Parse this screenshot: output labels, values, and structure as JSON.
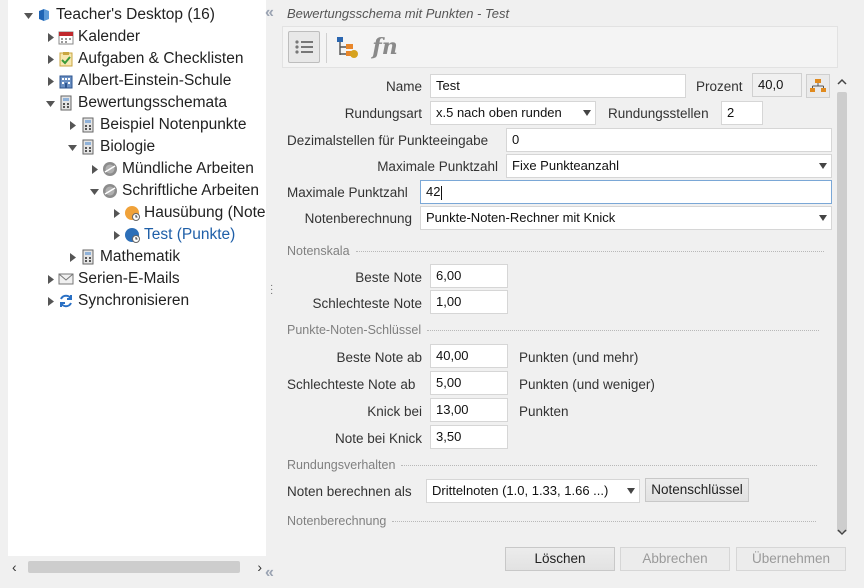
{
  "tree": {
    "items": [
      {
        "label": "Teacher's Desktop (16)",
        "icon": "desktop-icon",
        "expanded": true
      },
      {
        "label": "Kalender",
        "icon": "calendar-icon",
        "expanded": false
      },
      {
        "label": "Aufgaben & Checklisten",
        "icon": "checklist-icon",
        "expanded": false
      },
      {
        "label": "Albert-Einstein-Schule",
        "icon": "school-icon",
        "expanded": false
      },
      {
        "label": "Bewertungsschemata",
        "icon": "calculator-icon",
        "expanded": true
      },
      {
        "label": "Beispiel Notenpunkte",
        "icon": "calculator-icon",
        "expanded": false
      },
      {
        "label": "Biologie",
        "icon": "calculator-icon",
        "expanded": true
      },
      {
        "label": "Mündliche Arbeiten",
        "icon": "grey-disc-icon",
        "expanded": false
      },
      {
        "label": "Schriftliche Arbeiten",
        "icon": "grey-disc-icon",
        "expanded": true
      },
      {
        "label": "Hausübung (Note",
        "icon": "orange-disc-icon",
        "expanded": false
      },
      {
        "label": "Test (Punkte)",
        "icon": "blue-disc-icon",
        "expanded": false,
        "selected": true
      },
      {
        "label": "Mathematik",
        "icon": "calculator-icon",
        "expanded": false
      },
      {
        "label": "Serien-E-Mails",
        "icon": "mail-icon",
        "expanded": false
      },
      {
        "label": "Synchronisieren",
        "icon": "sync-icon",
        "expanded": false
      }
    ]
  },
  "panel": {
    "title": "Bewertungsschema mit Punkten - Test",
    "toolbar": {
      "icons": [
        "list-icon",
        "tree-structure-icon",
        "function-icon"
      ],
      "fn_label": "fn"
    }
  },
  "form": {
    "name_label": "Name",
    "name_value": "Test",
    "prozent_label": "Prozent",
    "prozent_value": "40,0",
    "rundungsart_label": "Rundungsart",
    "rundungsart_value": "x.5 nach oben runden",
    "rundungsstellen_label": "Rundungsstellen",
    "rundungsstellen_value": "2",
    "dezimal_label": "Dezimalstellen für Punkteeingabe",
    "dezimal_value": "0",
    "max_punktzahl_mode_label": "Maximale Punktzahl",
    "max_punktzahl_mode_value": "Fixe Punkteanzahl",
    "max_punktzahl_label": "Maximale Punktzahl",
    "max_punktzahl_value": "42",
    "notenberechnung_label": "Notenberechnung",
    "notenberechnung_value": "Punkte-Noten-Rechner mit Knick"
  },
  "notenskala": {
    "section": "Notenskala",
    "beste_label": "Beste Note",
    "beste_value": "6,00",
    "schlechteste_label": "Schlechteste Note",
    "schlechteste_value": "1,00"
  },
  "schluessel": {
    "section": "Punkte-Noten-Schlüssel",
    "beste_ab_label": "Beste Note ab",
    "beste_ab_value": "40,00",
    "beste_ab_suffix": "Punkten (und mehr)",
    "schlechteste_ab_label": "Schlechteste Note ab",
    "schlechteste_ab_value": "5,00",
    "schlechteste_ab_suffix": "Punkten (und weniger)",
    "knick_label": "Knick bei",
    "knick_value": "13,00",
    "knick_suffix": "Punkten",
    "note_knick_label": "Note bei Knick",
    "note_knick_value": "3,50"
  },
  "rundung": {
    "section": "Rundungsverhalten",
    "noten_label": "Noten berechnen als",
    "noten_value": "Drittelnoten (1.0, 1.33, 1.66 ...)",
    "notenschluessel_button": "Notenschlüssel"
  },
  "notenberechnung_section": "Notenberechnung",
  "buttons": {
    "loeschen": "Löschen",
    "abbrechen": "Abbrechen",
    "uebernehmen": "Übernehmen"
  },
  "colors": {
    "selected_text": "#1f5fa8",
    "focus_border": "#7aa7d6",
    "section_text": "#808080"
  }
}
